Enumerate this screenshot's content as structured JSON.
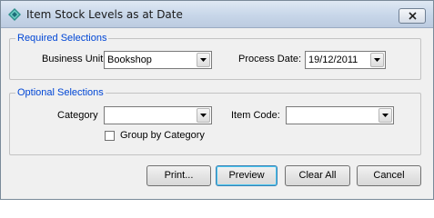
{
  "window": {
    "title": "Item Stock Levels as at Date"
  },
  "required": {
    "legend": "Required Selections",
    "business_unit_label": "Business Unit",
    "business_unit_value": "Bookshop",
    "process_date_label": "Process Date:",
    "process_date_value": "19/12/2011"
  },
  "optional": {
    "legend": "Optional Selections",
    "category_label": "Category",
    "category_value": "",
    "item_code_label": "Item Code:",
    "item_code_value": "",
    "group_by_label": "Group by Category",
    "group_by_checked": false
  },
  "buttons": {
    "print": "Print...",
    "preview": "Preview",
    "clear_all": "Clear All",
    "cancel": "Cancel"
  }
}
